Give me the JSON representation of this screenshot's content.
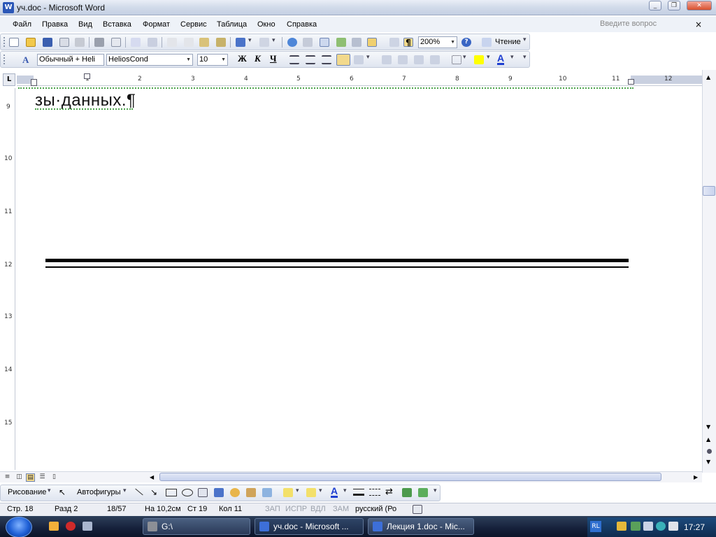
{
  "window": {
    "title": "уч.doc - Microsoft Word",
    "app_icon": "W",
    "btn_minimize": "_",
    "btn_maximize": "❐",
    "btn_close": "✕"
  },
  "menu": {
    "items": [
      "Файл",
      "Правка",
      "Вид",
      "Вставка",
      "Формат",
      "Сервис",
      "Таблица",
      "Окно",
      "Справка"
    ],
    "help_placeholder": "Введите вопрос",
    "help_close": "×"
  },
  "standard_toolbar": {
    "zoom": "200%",
    "read_label": "Чтение",
    "pilcrow": "¶"
  },
  "format_toolbar": {
    "style": "Обычный + Heli",
    "font": "HeliosCond",
    "size": "10",
    "bold": "Ж",
    "italic": "К",
    "underline": "Ч",
    "font_color_letter": "A",
    "style_icon_letter": "A"
  },
  "ruler": {
    "corner": "L",
    "h_ticks": [
      "1",
      "2",
      "3",
      "4",
      "5",
      "6",
      "7",
      "8",
      "9",
      "10",
      "11",
      "12"
    ],
    "v_ticks": [
      "9",
      "10",
      "11",
      "12",
      "13",
      "14",
      "15"
    ]
  },
  "document": {
    "text": "зы·данных.¶"
  },
  "drawing_toolbar": {
    "draw_label": "Рисование",
    "autoshapes_label": "Автофигуры",
    "font_color_letter": "A"
  },
  "status": {
    "page": "Стр.  18",
    "section": "Разд  2",
    "pages": "18/57",
    "at": "На  10,2см",
    "line": "Ст  19",
    "col": "Кол  11",
    "rec": "ЗАП",
    "trk": "ИСПР",
    "ext": "ВДЛ",
    "ovr": "ЗАМ",
    "lang": "русский (Ро"
  },
  "taskbar": {
    "buttons": [
      "G:\\",
      "уч.doc - Microsoft ...",
      "Лекция 1.doc - Mic..."
    ],
    "lang": "RL",
    "clock": "17:27"
  },
  "colors": {
    "accent": "#2b57b7",
    "highlight": "#ffff00",
    "font_color": "#1f3fd0",
    "grammar_squiggle": "#4aa24a"
  }
}
